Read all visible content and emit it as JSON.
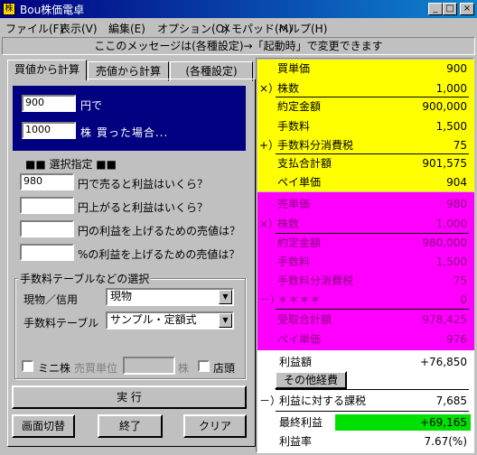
{
  "window": {
    "title": "Bou株価電卓",
    "icon_glyph": "株",
    "minimize": "_",
    "maximize": "□",
    "close": "×"
  },
  "menu": [
    "ファイル(F)",
    "表示(V)",
    "編集(E)",
    "オプション(O)",
    "メモパッド(M)",
    "ヘルプ(H)"
  ],
  "message": "ここのメッセージは(各種設定)→「起動時」で変更できます",
  "tabs": [
    "買値から計算",
    "売値から計算",
    "(各種設定)"
  ],
  "buy_input": {
    "price_value": "900",
    "price_label": "円で",
    "qty_value": "1000",
    "qty_label": "株 買った場合..."
  },
  "selection": {
    "header": "■■ 選択指定 ■■",
    "options": [
      {
        "value": "980",
        "label": "円で売ると利益はいくら？"
      },
      {
        "value": "",
        "label": "円上がると利益はいくら？"
      },
      {
        "value": "",
        "label": "円の利益を上げるための売値は？"
      },
      {
        "value": "",
        "label": "%の利益を上げるための売値は？"
      }
    ]
  },
  "fee_group": {
    "title": "手数料テーブルなどの選択",
    "genbutsu_label": "現物／信用",
    "genbutsu_value": "現物",
    "fee_table_label": "手数料テーブル",
    "fee_table_value": "サンプル・定額式",
    "mini_label": "ミニ株",
    "unit_label": "売買単位",
    "unit_value": "",
    "unit_suffix": "株",
    "store_label": "店頭"
  },
  "buttons": {
    "run": "実 行",
    "switch": "画面切替",
    "exit": "終了",
    "clear": "クリア"
  },
  "buy_results": [
    {
      "prefix": "",
      "label": "買単価",
      "value": "900"
    },
    {
      "prefix": "×）",
      "label": "株数",
      "value": "1,000"
    },
    {
      "prefix": "",
      "label": "約定金額",
      "value": "900,000"
    },
    {
      "prefix": "",
      "label": "手数料",
      "value": "1,500"
    },
    {
      "prefix": "+）",
      "label": "手数料分消費税",
      "value": "75"
    },
    {
      "prefix": "",
      "label": "支払合計額",
      "value": "901,575"
    },
    {
      "prefix": "",
      "label": "ペイ単価",
      "value": "904"
    }
  ],
  "sell_results": [
    {
      "prefix": "",
      "label": "売単価",
      "value": "980"
    },
    {
      "prefix": "×）",
      "label": "株数",
      "value": "1,000"
    },
    {
      "prefix": "",
      "label": "約定金額",
      "value": "980,000"
    },
    {
      "prefix": "",
      "label": "手数料",
      "value": "1,500"
    },
    {
      "prefix": "",
      "label": "手数料分消費税",
      "value": "75"
    },
    {
      "prefix": "－）",
      "label": "＊＊＊＊",
      "value": "0"
    },
    {
      "prefix": "",
      "label": "受取合計額",
      "value": "978,425"
    },
    {
      "prefix": "",
      "label": "ペイ単価",
      "value": "976"
    }
  ],
  "profit": {
    "label": "利益額",
    "value": "+76,850",
    "other_costs_button": "その他経費",
    "tax_prefix": "－）",
    "tax_label": "利益に対する課税",
    "tax_value": "7,685",
    "final_label": "最終利益",
    "final_value": "+69,165",
    "rate_label": "利益率",
    "rate_value": "7.67(%)"
  },
  "colors": {
    "title_bar": "#000080",
    "buy_section": "#ffff00",
    "sell_section": "#ff00ff",
    "final_profit": "#00e000"
  }
}
